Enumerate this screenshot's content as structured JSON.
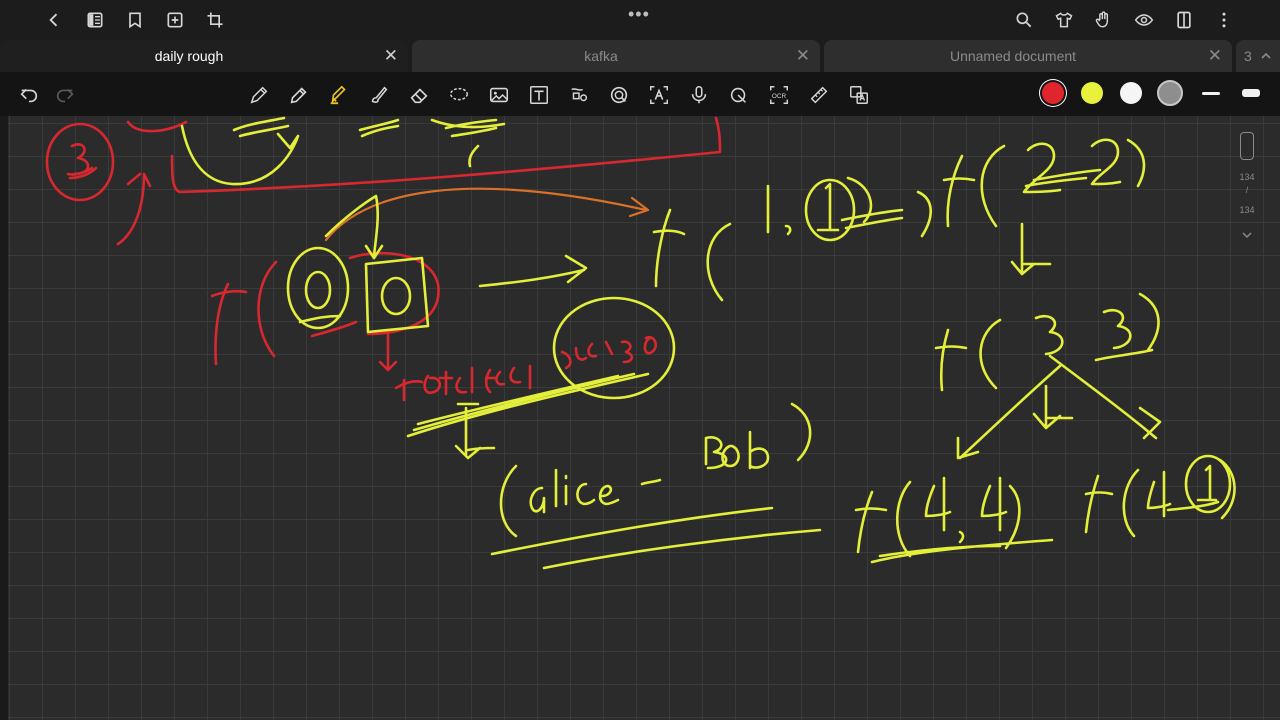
{
  "app": {
    "icons": [
      "back-icon",
      "outline-icon",
      "bookmark-icon",
      "add-page-icon",
      "crop-icon",
      "more-dots-icon",
      "search-icon",
      "shirt-icon",
      "gesture-icon",
      "eye-icon",
      "reader-icon",
      "overflow-menu-icon"
    ],
    "more_glyph": "•••"
  },
  "tabs": [
    {
      "label": "daily rough",
      "active": true
    },
    {
      "label": "kafka",
      "active": false
    },
    {
      "label": "Unnamed document",
      "active": false
    }
  ],
  "tab_close_glyph": "✕",
  "tab_count": "3",
  "toolbar": {
    "tools": [
      "undo",
      "redo",
      "pen",
      "pencil",
      "highlighter",
      "brush",
      "eraser",
      "lasso",
      "image",
      "text",
      "shape-recognition",
      "sticker",
      "text-recognition",
      "microphone",
      "ruler-shape",
      "ocr",
      "measure",
      "translate"
    ],
    "colors": [
      "#e0262c",
      "#e8f23c",
      "#f5f5f5",
      "#8e8e8e"
    ],
    "ocr_label": "OCR"
  },
  "page_scroller": {
    "current": "134",
    "separator": "/",
    "total": "134"
  },
  "colors": {
    "canvas": "#2b2b2b",
    "grid": "#3a3a3a",
    "ink_yellow": "#e3ef3a",
    "ink_red": "#d8282f"
  }
}
